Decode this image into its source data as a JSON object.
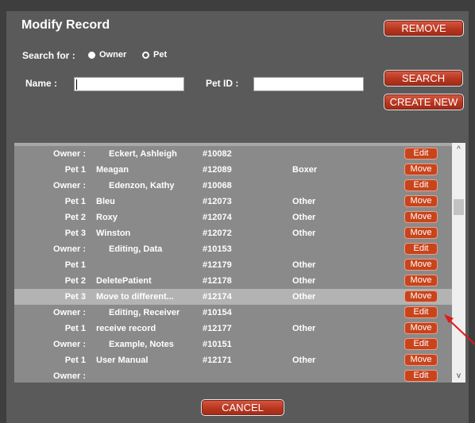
{
  "dialog": {
    "title": "Modify Record",
    "remove_label": "REMOVE",
    "search_label": "SEARCH",
    "create_label": "CREATE NEW",
    "cancel_label": "CANCEL"
  },
  "search": {
    "label": "Search for :",
    "options": [
      {
        "label": "Owner",
        "selected": true
      },
      {
        "label": "Pet",
        "selected": false
      }
    ],
    "name_label": "Name :",
    "name_value": "",
    "petid_label": "Pet ID :",
    "petid_value": ""
  },
  "list": {
    "rows": [
      {
        "type": "Owner :",
        "name": "Eckert, Ashleigh",
        "id": "#10082",
        "category": "",
        "action": "Edit",
        "owner": true
      },
      {
        "type": "Pet 1",
        "name": "Meagan",
        "id": "#12089",
        "category": "Boxer",
        "action": "Move",
        "owner": false
      },
      {
        "type": "Owner :",
        "name": "Edenzon, Kathy",
        "id": "#10068",
        "category": "",
        "action": "Edit",
        "owner": true
      },
      {
        "type": "Pet 1",
        "name": "Bleu",
        "id": "#12073",
        "category": "Other",
        "action": "Move",
        "owner": false
      },
      {
        "type": "Pet 2",
        "name": "Roxy",
        "id": "#12074",
        "category": "Other",
        "action": "Move",
        "owner": false
      },
      {
        "type": "Pet 3",
        "name": "Winston",
        "id": "#12072",
        "category": "Other",
        "action": "Move",
        "owner": false
      },
      {
        "type": "Owner :",
        "name": "Editing, Data",
        "id": "#10153",
        "category": "",
        "action": "Edit",
        "owner": true
      },
      {
        "type": "Pet 1",
        "name": "",
        "id": "#12179",
        "category": "Other",
        "action": "Move",
        "owner": false
      },
      {
        "type": "Pet 2",
        "name": "DeletePatient",
        "id": "#12178",
        "category": "Other",
        "action": "Move",
        "owner": false
      },
      {
        "type": "Pet 3",
        "name": "Move to different...",
        "id": "#12174",
        "category": "Other",
        "action": "Move",
        "owner": false,
        "selected": true
      },
      {
        "type": "Owner :",
        "name": "Editing, Receiver",
        "id": "#10154",
        "category": "",
        "action": "Edit",
        "owner": true
      },
      {
        "type": "Pet 1",
        "name": "receive record",
        "id": "#12177",
        "category": "Other",
        "action": "Move",
        "owner": false
      },
      {
        "type": "Owner :",
        "name": "Example, Notes",
        "id": "#10151",
        "category": "",
        "action": "Edit",
        "owner": true
      },
      {
        "type": "Pet 1",
        "name": "User Manual",
        "id": "#12171",
        "category": "Other",
        "action": "Move",
        "owner": false
      },
      {
        "type": "Owner :",
        "name": "",
        "id": "",
        "category": "",
        "action": "Edit",
        "owner": true
      }
    ]
  },
  "scrollbar": {
    "up_glyph": "^",
    "down_glyph": "v"
  },
  "colors": {
    "accent": "#c8441c",
    "annotation_arrow": "#e11919"
  }
}
